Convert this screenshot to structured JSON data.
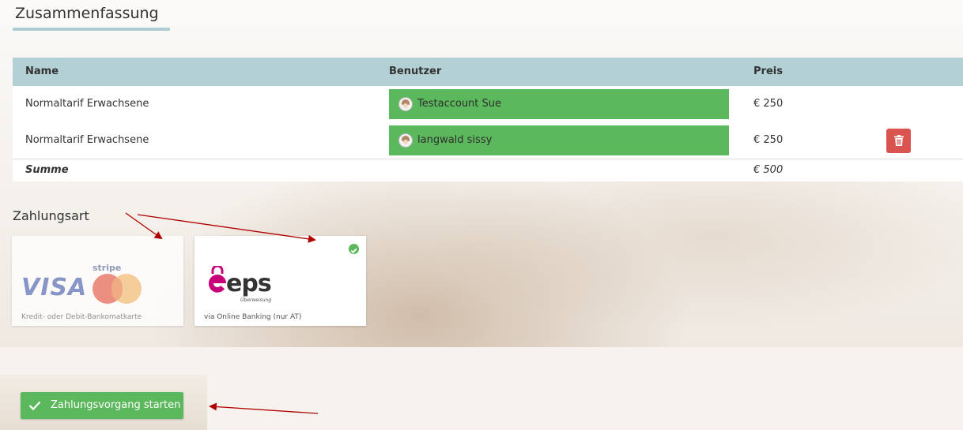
{
  "summary": {
    "title": "Zusammenfassung"
  },
  "table": {
    "headers": {
      "name": "Name",
      "user": "Benutzer",
      "price": "Preis"
    },
    "rows": [
      {
        "name": "Normaltarif Erwachsene",
        "user": "Testaccount Sue",
        "price": "€ 250"
      },
      {
        "name": "Normaltarif Erwachsene",
        "user": "langwald sissy",
        "price": "€ 250"
      }
    ],
    "sum_label": "Summe",
    "sum_value": "€ 500"
  },
  "payment": {
    "title": "Zahlungsart",
    "methods": [
      {
        "brand": "stripe",
        "logo_text": "VISA",
        "caption": "Kredit- oder Debit-Bankomatkarte",
        "selected": false
      },
      {
        "brand": "eps",
        "logo_text": "eps",
        "logo_subtext": "Überweisung",
        "caption": "via Online Banking (nur AT)",
        "selected": true
      }
    ]
  },
  "actions": {
    "start_payment_label": "Zahlungsvorgang starten"
  },
  "colors": {
    "header_bg": "#b3d0d5",
    "user_badge": "#5cb85c",
    "delete_button": "#d9534f",
    "primary_button": "#5cb85c",
    "annotation_arrow": "#b10000",
    "eps_magenta": "#c8007a"
  },
  "icons": {
    "delete": "trash-icon",
    "user": "avatar-icon",
    "selected": "check-circle-icon",
    "button": "check-icon"
  }
}
